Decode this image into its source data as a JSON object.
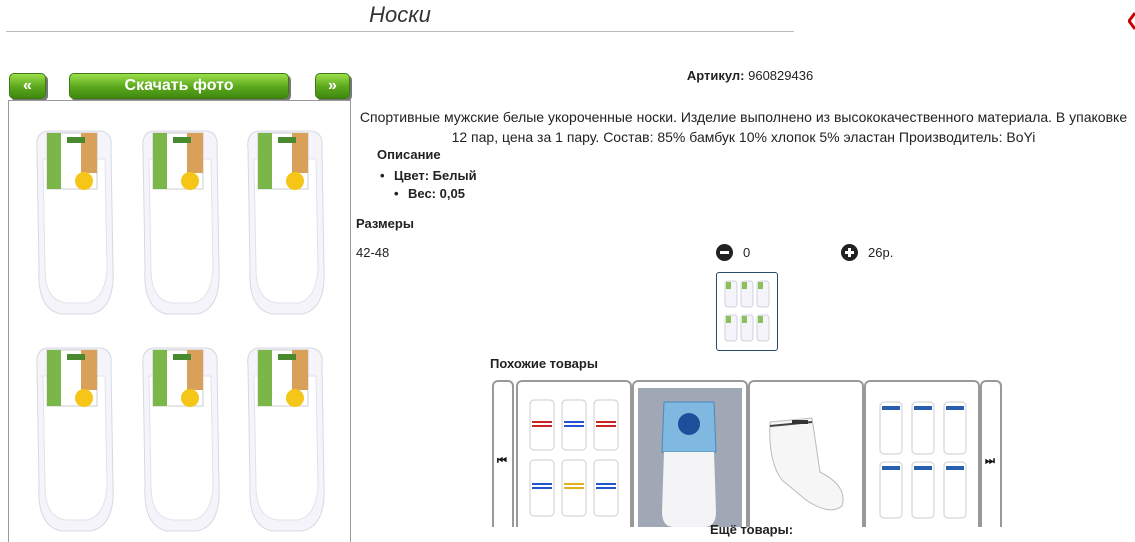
{
  "page": {
    "title": "Носки"
  },
  "gallery": {
    "prev_label": "«",
    "download_label": "Скачать фото",
    "next_label": "»"
  },
  "product": {
    "article_label": "Артикул:",
    "article_value": "960829436",
    "description": "Спортивные мужские белые укороченные носки. Изделие выполнено из высококачественного материала. В упаковке 12 пар, цена за 1 пару. Состав: 85% бамбук 10% хлопок 5% эластан Производитель: BoYi",
    "description_heading": "Описание",
    "properties": [
      "Цвет: Белый",
      "Вес: 0,05"
    ]
  },
  "sizes": {
    "heading": "Размеры",
    "rows": [
      {
        "size": "42-48",
        "quantity": "0",
        "price": "26р."
      }
    ]
  },
  "similar": {
    "heading": "Похожие товары",
    "prev_icon": "skip-back-icon",
    "next_icon": "skip-forward-icon"
  },
  "more": {
    "heading": "Ещё товары:"
  },
  "colors": {
    "accent_green": "#5aa61c",
    "corner_red": "#cc0000"
  }
}
